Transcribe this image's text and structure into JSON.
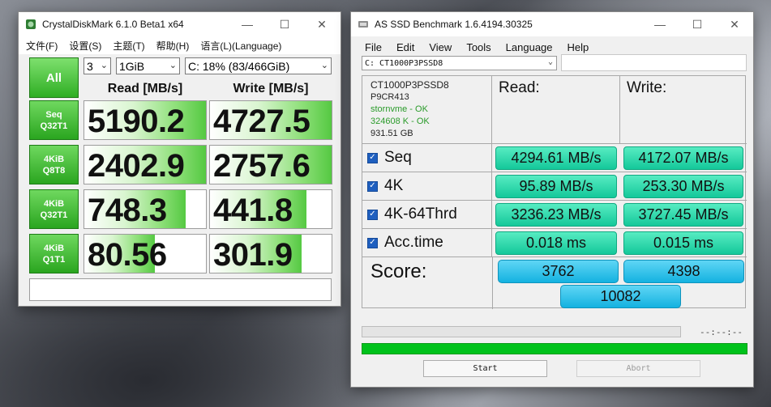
{
  "cdm": {
    "title": "CrystalDiskMark 6.1.0 Beta1 x64",
    "menu": [
      "文件(F)",
      "设置(S)",
      "主题(T)",
      "帮助(H)",
      "语言(L)(Language)"
    ],
    "all_label": "All",
    "count": "3",
    "size": "1GiB",
    "drive": "C: 18% (83/466GiB)",
    "read_header": "Read [MB/s]",
    "write_header": "Write [MB/s]",
    "rows": [
      {
        "line1": "Seq",
        "line2": "Q32T1",
        "read": "5190.2",
        "write": "4727.5",
        "read_fill": 1.0,
        "write_fill": 1.0
      },
      {
        "line1": "4KiB",
        "line2": "Q8T8",
        "read": "2402.9",
        "write": "2757.6",
        "read_fill": 1.0,
        "write_fill": 1.0
      },
      {
        "line1": "4KiB",
        "line2": "Q32T1",
        "read": "748.3",
        "write": "441.8",
        "read_fill": 0.83,
        "write_fill": 0.79
      },
      {
        "line1": "4KiB",
        "line2": "Q1T1",
        "read": "80.56",
        "write": "301.9",
        "read_fill": 0.58,
        "write_fill": 0.75
      }
    ],
    "comment": ""
  },
  "asssd": {
    "title": "AS SSD Benchmark 1.6.4194.30325",
    "menu": [
      "File",
      "Edit",
      "View",
      "Tools",
      "Language",
      "Help"
    ],
    "drive_select": "C: CT1000P3PSSD8",
    "info": {
      "model": "CT1000P3PSSD8",
      "firmware": "P9CR413",
      "driver": "stornvme - OK",
      "alignment": "324608 K - OK",
      "capacity": "931.51 GB"
    },
    "read_header": "Read:",
    "write_header": "Write:",
    "tests": [
      {
        "name": "Seq",
        "read": "4294.61 MB/s",
        "write": "4172.07 MB/s"
      },
      {
        "name": "4K",
        "read": "95.89 MB/s",
        "write": "253.30 MB/s"
      },
      {
        "name": "4K-64Thrd",
        "read": "3236.23 MB/s",
        "write": "3727.45 MB/s"
      },
      {
        "name": "Acc.time",
        "read": "0.018 ms",
        "write": "0.015 ms"
      }
    ],
    "score_label": "Score:",
    "score_read": "3762",
    "score_write": "4398",
    "score_total": "10082",
    "elapsed": "--:--:--",
    "progress": 1.0,
    "start_label": "Start",
    "abort_label": "Abort"
  }
}
